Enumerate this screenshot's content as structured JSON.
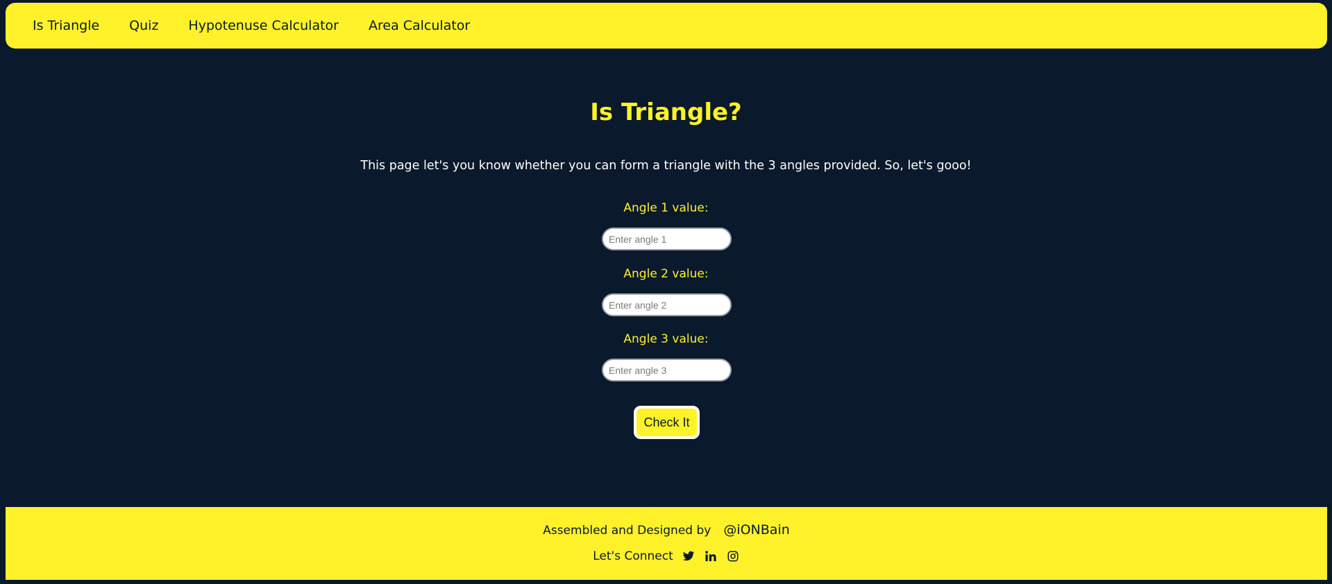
{
  "nav": {
    "items": [
      {
        "label": "Is Triangle"
      },
      {
        "label": "Quiz"
      },
      {
        "label": "Hypotenuse Calculator"
      },
      {
        "label": "Area Calculator"
      }
    ]
  },
  "main": {
    "title": "Is Triangle?",
    "intro": "This page let's you know whether you can form a triangle with the 3 angles provided. So, let's gooo!",
    "fields": [
      {
        "label": "Angle 1 value:",
        "placeholder": "Enter angle 1",
        "value": ""
      },
      {
        "label": "Angle 2 value:",
        "placeholder": "Enter angle 2",
        "value": ""
      },
      {
        "label": "Angle 3 value:",
        "placeholder": "Enter angle 3",
        "value": ""
      }
    ],
    "button_label": "Check It"
  },
  "footer": {
    "credit_text": "Assembled and Designed by",
    "handle": "@iONBain",
    "connect_text": "Let's Connect",
    "icons": [
      "twitter-icon",
      "linkedin-icon",
      "instagram-icon"
    ]
  },
  "colors": {
    "background": "#0b192c",
    "accent": "#fff22a",
    "text_light": "#ffffff"
  }
}
